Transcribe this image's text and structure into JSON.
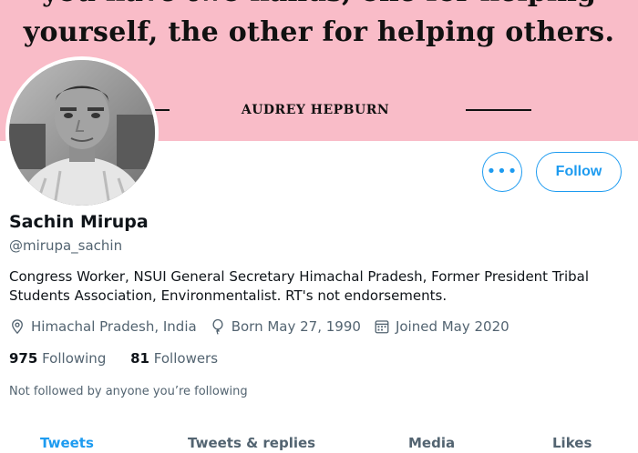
{
  "banner": {
    "quote_line1": "you have two hands, one for helping",
    "quote_line2": "yourself, the other for helping others.",
    "author": "AUDREY HEPBURN",
    "bg_color": "#f9bcc8"
  },
  "profile": {
    "name": "Sachin Mirupa",
    "handle": "@mirupa_sachin",
    "bio": "Congress Worker, NSUI General Secretary Himachal Pradesh, Former President Tribal Students Association, Environmentalist. RT's not endorsements.",
    "location": "Himachal Pradesh, India",
    "birthday": "Born May 27, 1990",
    "joined": "Joined May 2020",
    "following_count": "975",
    "following_label": "Following",
    "followers_count": "81",
    "followers_label": "Followers",
    "mutuals_note": "Not followed by anyone you’re following"
  },
  "actions": {
    "more_label": "•••",
    "follow_label": "Follow",
    "accent": "#1d9bf0"
  },
  "tabs": [
    {
      "label": "Tweets"
    },
    {
      "label": "Tweets & replies"
    },
    {
      "label": "Media"
    },
    {
      "label": "Likes"
    }
  ],
  "icons": [
    "location-pin-icon",
    "balloon-icon",
    "calendar-icon",
    "more-icon"
  ]
}
